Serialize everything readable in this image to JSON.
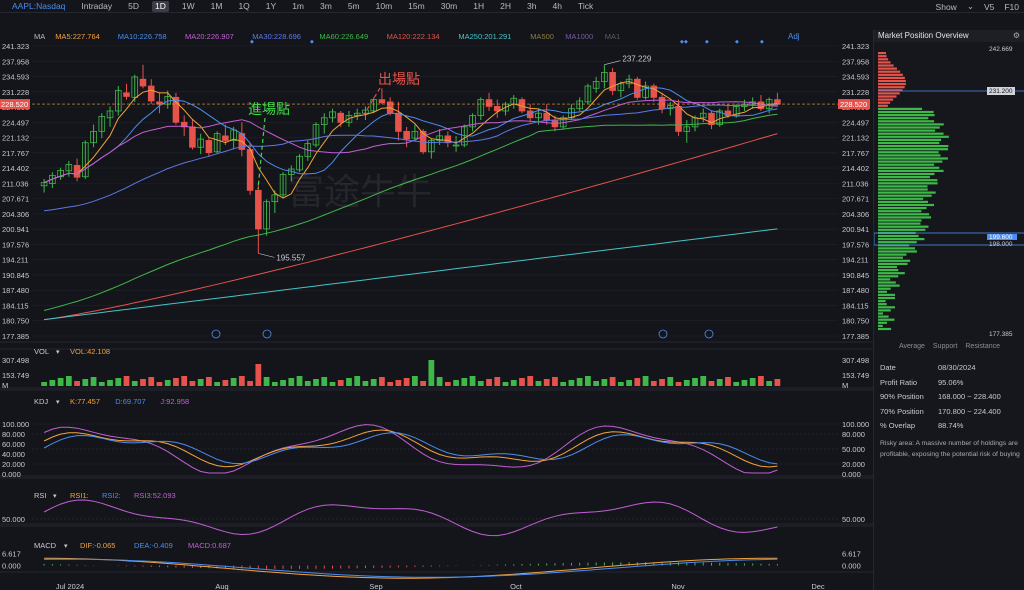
{
  "toolbar": {
    "ticker": "AAPL:Nasdaq",
    "timeframes": [
      "Intraday",
      "5D",
      "1D",
      "1W",
      "1M",
      "1Q",
      "1Y",
      "1m",
      "3m",
      "5m",
      "10m",
      "15m",
      "30m",
      "1H",
      "2H",
      "3h",
      "4h",
      "Tick"
    ],
    "active": "1D",
    "right": [
      "Show",
      "⌄",
      "V5",
      "F10"
    ]
  },
  "chart_data": [
    {
      "type": "candlestick",
      "panel": "main",
      "ma_legend": [
        {
          "label": "MA",
          "value": "",
          "color": "#b7bac2"
        },
        {
          "label": "MA5",
          "value": "227.764",
          "color": "#f2a33a"
        },
        {
          "label": "MA10",
          "value": "226.758",
          "color": "#4b8df0"
        },
        {
          "label": "MA20",
          "value": "226.907",
          "color": "#c25fd4"
        },
        {
          "label": "MA30",
          "value": "228.696",
          "color": "#5e78e8"
        },
        {
          "label": "MA60",
          "value": "226.649",
          "color": "#3fb84a"
        },
        {
          "label": "MA120",
          "value": "222.134",
          "color": "#e5534b"
        },
        {
          "label": "MA250",
          "value": "201.291",
          "color": "#46c3c8"
        },
        {
          "label": "MA500",
          "value": "",
          "color": "#8b7b4a"
        },
        {
          "label": "MA1000",
          "value": "",
          "color": "#7a5aa0"
        },
        {
          "label": "MA1",
          "value": "",
          "color": "#5a5d66"
        }
      ],
      "adj_label": "Adj",
      "y_ticks": [
        "241.323",
        "237.958",
        "234.593",
        "231.228",
        "227.863",
        "224.497",
        "221.132",
        "217.767",
        "214.402",
        "211.036",
        "207.671",
        "204.306",
        "200.941",
        "197.576",
        "194.211",
        "190.845",
        "187.480",
        "184.115",
        "180.750",
        "177.385"
      ],
      "ylim": [
        177.385,
        241.323
      ],
      "current_price": "228.520",
      "annotations": {
        "high": "237.229",
        "low": "195.557",
        "entry": "進場點",
        "exit": "出場點",
        "watermark": "富途牛牛"
      },
      "x_labels": [
        "Jul 2024",
        "Aug",
        "Sep",
        "Oct",
        "Nov",
        "Dec"
      ],
      "candles": [
        [
          210.5,
          212.0,
          209.0,
          211.2
        ],
        [
          211.0,
          213.5,
          210.0,
          212.8
        ],
        [
          212.5,
          214.5,
          211.8,
          213.9
        ],
        [
          213.8,
          216.0,
          212.5,
          215.2
        ],
        [
          215.0,
          216.5,
          211.5,
          212.4
        ],
        [
          212.5,
          220.5,
          212.0,
          220.0
        ],
        [
          220.0,
          224.0,
          219.0,
          222.5
        ],
        [
          222.5,
          226.5,
          221.0,
          225.8
        ],
        [
          225.5,
          228.0,
          223.5,
          227.0
        ],
        [
          227.0,
          232.5,
          226.0,
          231.5
        ],
        [
          231.0,
          233.0,
          229.5,
          230.2
        ],
        [
          230.0,
          235.0,
          229.0,
          234.5
        ],
        [
          234.0,
          237.2,
          232.0,
          232.5
        ],
        [
          232.5,
          234.0,
          228.5,
          229.2
        ],
        [
          229.0,
          231.0,
          226.5,
          228.5
        ],
        [
          228.5,
          231.5,
          227.5,
          230.2
        ],
        [
          230.0,
          231.0,
          224.0,
          224.5
        ],
        [
          224.5,
          226.0,
          221.5,
          223.5
        ],
        [
          223.5,
          225.0,
          218.5,
          219.0
        ],
        [
          219.0,
          222.0,
          217.5,
          220.8
        ],
        [
          220.5,
          221.0,
          217.0,
          217.8
        ],
        [
          218.0,
          222.5,
          217.5,
          222.0
        ],
        [
          221.5,
          224.0,
          219.5,
          220.5
        ],
        [
          220.5,
          223.5,
          218.5,
          222.8
        ],
        [
          222.0,
          224.5,
          217.0,
          218.5
        ],
        [
          218.5,
          220.0,
          208.5,
          209.5
        ],
        [
          209.5,
          211.0,
          195.6,
          201.0
        ],
        [
          201.0,
          207.5,
          199.5,
          207.0
        ],
        [
          207.0,
          209.5,
          204.5,
          208.5
        ],
        [
          208.5,
          213.5,
          208.0,
          213.0
        ],
        [
          213.0,
          215.0,
          211.5,
          214.2
        ],
        [
          214.0,
          217.5,
          213.5,
          217.0
        ],
        [
          217.0,
          220.5,
          216.0,
          219.8
        ],
        [
          219.5,
          224.5,
          219.0,
          224.0
        ],
        [
          224.0,
          226.5,
          222.0,
          225.5
        ],
        [
          225.5,
          227.5,
          224.5,
          226.8
        ],
        [
          226.5,
          227.0,
          223.5,
          224.5
        ],
        [
          224.5,
          227.0,
          223.5,
          226.0
        ],
        [
          226.0,
          227.5,
          225.0,
          226.5
        ],
        [
          226.5,
          228.0,
          225.0,
          227.2
        ],
        [
          227.0,
          230.0,
          226.5,
          229.5
        ],
        [
          229.5,
          232.0,
          228.5,
          228.8
        ],
        [
          229.0,
          230.0,
          226.0,
          226.5
        ],
        [
          226.5,
          229.0,
          220.5,
          222.5
        ],
        [
          222.5,
          223.5,
          219.0,
          220.8
        ],
        [
          221.0,
          224.0,
          220.5,
          222.5
        ],
        [
          222.5,
          223.0,
          217.5,
          218.0
        ],
        [
          218.0,
          221.0,
          216.5,
          220.5
        ],
        [
          220.5,
          223.0,
          219.5,
          221.5
        ],
        [
          221.5,
          222.5,
          219.0,
          220.0
        ],
        [
          219.5,
          221.5,
          218.0,
          219.5
        ],
        [
          219.5,
          224.0,
          219.0,
          223.5
        ],
        [
          223.5,
          226.5,
          222.5,
          226.0
        ],
        [
          226.0,
          230.0,
          225.0,
          229.5
        ],
        [
          229.5,
          231.0,
          227.0,
          228.0
        ],
        [
          228.0,
          229.5,
          225.5,
          227.0
        ],
        [
          227.0,
          229.0,
          226.0,
          228.5
        ],
        [
          228.5,
          230.5,
          227.5,
          229.8
        ],
        [
          229.5,
          230.0,
          226.5,
          227.0
        ],
        [
          227.0,
          228.5,
          224.5,
          225.5
        ],
        [
          225.5,
          227.5,
          224.0,
          226.5
        ],
        [
          226.5,
          228.5,
          224.0,
          225.0
        ],
        [
          225.0,
          226.0,
          222.5,
          223.5
        ],
        [
          223.5,
          226.0,
          223.0,
          225.5
        ],
        [
          225.5,
          228.5,
          225.0,
          227.5
        ],
        [
          227.5,
          230.0,
          227.0,
          229.2
        ],
        [
          229.0,
          233.0,
          228.5,
          232.5
        ],
        [
          232.0,
          234.5,
          231.0,
          233.5
        ],
        [
          233.5,
          237.2,
          232.0,
          235.5
        ],
        [
          235.5,
          236.5,
          230.5,
          231.5
        ],
        [
          231.5,
          233.5,
          230.0,
          233.0
        ],
        [
          233.0,
          235.0,
          232.0,
          234.0
        ],
        [
          234.0,
          234.5,
          229.5,
          230.0
        ],
        [
          230.0,
          233.5,
          229.5,
          232.5
        ],
        [
          232.5,
          233.0,
          229.0,
          230.0
        ],
        [
          230.0,
          231.0,
          226.5,
          227.5
        ],
        [
          227.5,
          229.0,
          226.0,
          228.2
        ],
        [
          228.0,
          229.5,
          221.5,
          222.5
        ],
        [
          222.5,
          225.0,
          220.0,
          223.5
        ],
        [
          223.5,
          226.0,
          222.5,
          225.5
        ],
        [
          225.5,
          227.5,
          224.5,
          226.5
        ],
        [
          226.5,
          227.0,
          223.0,
          224.0
        ],
        [
          224.0,
          227.5,
          223.5,
          227.0
        ],
        [
          227.0,
          228.5,
          225.5,
          226.0
        ],
        [
          226.0,
          228.5,
          225.5,
          228.0
        ],
        [
          228.0,
          229.5,
          227.0,
          228.5
        ],
        [
          228.5,
          230.0,
          227.5,
          229.0
        ],
        [
          229.0,
          230.5,
          227.0,
          227.5
        ],
        [
          227.5,
          230.0,
          226.5,
          229.5
        ],
        [
          229.5,
          231.0,
          228.0,
          228.5
        ]
      ]
    },
    {
      "type": "bar",
      "panel": "volume",
      "legend": "VOL",
      "value_label": "VOL:42.108",
      "y_ticks": [
        "307.498",
        "153.749"
      ],
      "unit": "M",
      "ylim": [
        0,
        307.498
      ]
    },
    {
      "type": "line",
      "panel": "kdj",
      "legend": "KDJ",
      "series": [
        {
          "name": "K:77.457",
          "color": "#f2a33a"
        },
        {
          "name": "D:69.707",
          "color": "#4b8df0"
        },
        {
          "name": "J:92.958",
          "color": "#c25fd4"
        }
      ],
      "y_ticks_left": [
        "100.000",
        "80.000",
        "60.000",
        "40.000",
        "20.000",
        "0.000"
      ],
      "y_ticks_right": [
        "100.000",
        "80.000",
        "50.000",
        "20.000",
        "0.000"
      ],
      "ylim": [
        0,
        100
      ]
    },
    {
      "type": "line",
      "panel": "rsi",
      "legend": "RSI",
      "series": [
        {
          "name": "RSI1:",
          "color": "#f2a33a"
        },
        {
          "name": "RSI2:",
          "color": "#4b8df0"
        },
        {
          "name": "RSI3:52.093",
          "color": "#c25fd4"
        }
      ],
      "y_ticks": [
        "50.000"
      ],
      "ylim": [
        20,
        85
      ]
    },
    {
      "type": "bar",
      "panel": "macd",
      "legend": "MACD",
      "series": [
        {
          "name": "DIF:-0.065",
          "color": "#f2a33a"
        },
        {
          "name": "DEA:-0.409",
          "color": "#4b8df0"
        },
        {
          "name": "MACD:0.687",
          "color": "#c25fd4"
        }
      ],
      "y_ticks": [
        "6.617",
        "0.000"
      ],
      "ylim": [
        -8,
        7.5
      ]
    }
  ],
  "position_panel": {
    "title": "Market Position Overview",
    "price_labels": {
      "top": "242.669",
      "current": "231.200",
      "mid_a": "199.600",
      "mid_b": "198.000",
      "bottom": "177.385"
    },
    "legend": [
      "Average",
      "Support",
      "Resistance"
    ],
    "stats": [
      {
        "k": "Date",
        "v": "08/30/2024"
      },
      {
        "k": "Profit Ratio",
        "v": "95.06%"
      },
      {
        "k": "90% Position",
        "v": "168.000 ~ 228.400"
      },
      {
        "k": "70% Position",
        "v": "170.800 ~ 224.400"
      },
      {
        "k": "% Overlap",
        "v": "88.74%"
      }
    ],
    "note": "Risky area: A massive number of holdings are profitable, exposing the potential risk of buying",
    "colors": {
      "profit": "#3fb84a",
      "loss": "#e5534b",
      "current": "#4b8df0"
    }
  }
}
